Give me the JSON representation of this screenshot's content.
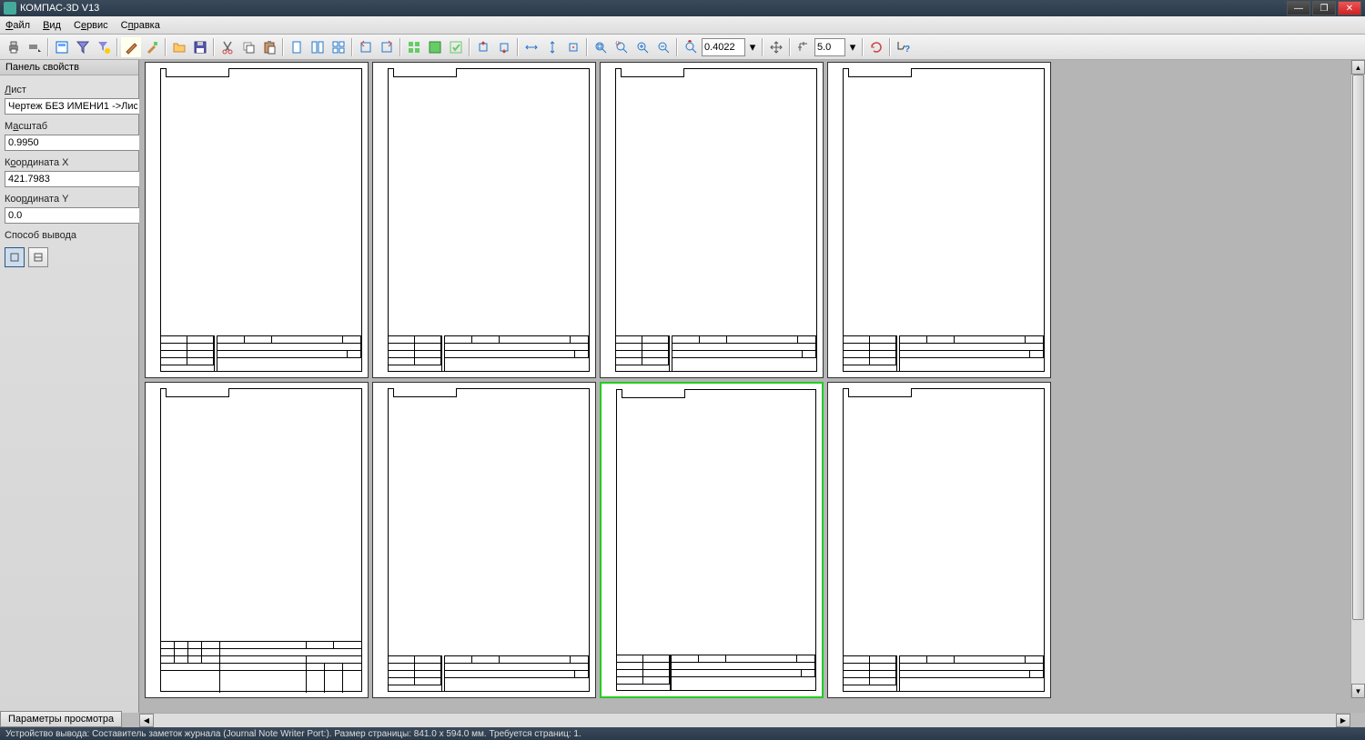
{
  "title": "КОМПАС-3D V13",
  "menu": {
    "file": "Файл",
    "view": "Вид",
    "service": "Сервис",
    "help": "Справка"
  },
  "toolbar": {
    "zoom_combo": "0.4022",
    "step_combo": "5.0"
  },
  "panel": {
    "title": "Панель свойств",
    "sheet_label": "Лист",
    "sheet_value": "Чертеж БЕЗ ИМЕНИ1 ->Лис",
    "scale_label": "Масштаб",
    "scale_value": "0.9950",
    "coordx_label": "Координата X",
    "coordx_value": "421.7983",
    "coordy_label": "Координата Y",
    "coordy_value": "0.0",
    "output_label": "Способ вывода"
  },
  "bottom_tab": "Параметры просмотра",
  "status": "Устройство вывода: Составитель заметок журнала (Journal Note Writer Port:). Размер страницы: 841.0 х 594.0 мм. Требуется страниц: 1.",
  "selected_sheet_index": 6
}
